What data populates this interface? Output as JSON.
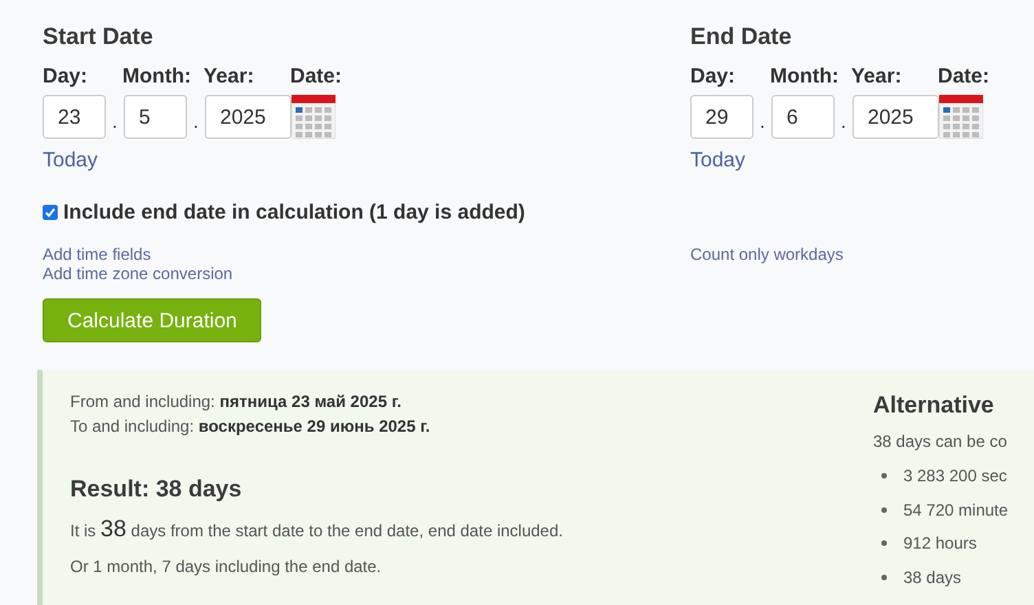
{
  "start": {
    "heading": "Start Date",
    "labels": [
      "Day:",
      "Month:",
      "Year:",
      "Date:"
    ],
    "day": "23",
    "month": "5",
    "year": "2025",
    "separator": ".",
    "today": "Today"
  },
  "end": {
    "heading": "End Date",
    "labels": [
      "Day:",
      "Month:",
      "Year:",
      "Date:"
    ],
    "day": "29",
    "month": "6",
    "year": "2025",
    "separator": ".",
    "today": "Today"
  },
  "include_end": {
    "label": "Include end date in calculation (1 day is added)",
    "checked": true
  },
  "links_left": [
    "Add time fields",
    "Add time zone conversion"
  ],
  "links_right": [
    "Count only workdays"
  ],
  "button": "Calculate Duration",
  "result": {
    "from": "From and including: **пятница 23 май 2025 г.**",
    "to": "To and including: **воскресенье 29 июнь 2025 г.**",
    "heading": "Result: 38 days",
    "sentence": {
      "before": "It is ",
      "number": "38",
      "after": " days from the start date to the end date, end date included."
    },
    "months": "Or 1 month, 7 days including the end date."
  },
  "alternative": {
    "heading": "Alternative",
    "intro": "38 days can be co",
    "items": [
      "3 283 200 sec",
      "54 720 minute",
      "912 hours",
      "38 days"
    ]
  }
}
